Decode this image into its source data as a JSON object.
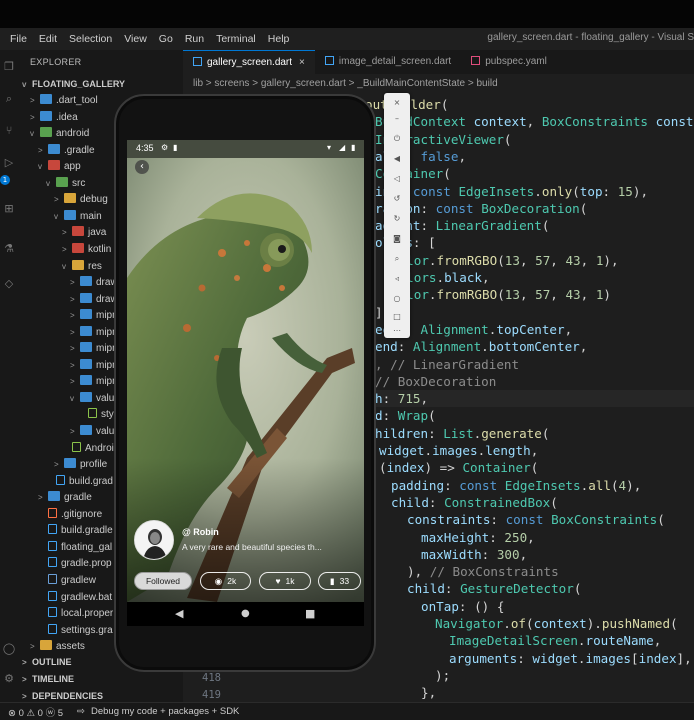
{
  "window_title": "gallery_screen.dart - floating_gallery - Visual S",
  "menu": [
    "File",
    "Edit",
    "Selection",
    "View",
    "Go",
    "Run",
    "Terminal",
    "Help"
  ],
  "sidebar": {
    "title": "EXPLORER",
    "project": "FLOATING_GALLERY",
    "rows": [
      {
        "label": ".dart_tool",
        "depth": 1,
        "kind": "folder",
        "chev": ">"
      },
      {
        "label": ".idea",
        "depth": 1,
        "kind": "folder",
        "chev": ">"
      },
      {
        "label": "android",
        "depth": 1,
        "kind": "folder g",
        "chev": "v"
      },
      {
        "label": ".gradle",
        "depth": 2,
        "kind": "folder",
        "chev": ">"
      },
      {
        "label": "app",
        "depth": 2,
        "kind": "folder r",
        "chev": "v"
      },
      {
        "label": "src",
        "depth": 3,
        "kind": "folder g",
        "chev": "v"
      },
      {
        "label": "debug",
        "depth": 4,
        "kind": "folder y",
        "chev": ">"
      },
      {
        "label": "main",
        "depth": 4,
        "kind": "folder",
        "chev": "v"
      },
      {
        "label": "java",
        "depth": 5,
        "kind": "folder r",
        "chev": ">"
      },
      {
        "label": "kotlin",
        "depth": 5,
        "kind": "folder r",
        "chev": ">"
      },
      {
        "label": "res",
        "depth": 5,
        "kind": "folder y",
        "chev": "v"
      },
      {
        "label": "drawa",
        "depth": 6,
        "kind": "folder",
        "chev": ">"
      },
      {
        "label": "drawa",
        "depth": 6,
        "kind": "folder",
        "chev": ">"
      },
      {
        "label": "mipm",
        "depth": 6,
        "kind": "folder",
        "chev": ">"
      },
      {
        "label": "mipm",
        "depth": 6,
        "kind": "folder",
        "chev": ">"
      },
      {
        "label": "mipm",
        "depth": 6,
        "kind": "folder",
        "chev": ">"
      },
      {
        "label": "mipm",
        "depth": 6,
        "kind": "folder",
        "chev": ">"
      },
      {
        "label": "mipm",
        "depth": 6,
        "kind": "folder",
        "chev": ">"
      },
      {
        "label": "values",
        "depth": 6,
        "kind": "folder",
        "chev": "v"
      },
      {
        "label": "style",
        "depth": 7,
        "kind": "file g",
        "chev": ""
      },
      {
        "label": "values",
        "depth": 6,
        "kind": "folder",
        "chev": ">"
      },
      {
        "label": "Android",
        "depth": 5,
        "kind": "file g",
        "chev": ""
      },
      {
        "label": "profile",
        "depth": 4,
        "kind": "folder",
        "chev": ">"
      },
      {
        "label": "build.grad",
        "depth": 3,
        "kind": "file d",
        "chev": ""
      },
      {
        "label": "gradle",
        "depth": 2,
        "kind": "folder",
        "chev": ">"
      },
      {
        "label": ".gitignore",
        "depth": 2,
        "kind": "file o",
        "chev": ""
      },
      {
        "label": "build.gradle",
        "depth": 2,
        "kind": "file d",
        "chev": ""
      },
      {
        "label": "floating_gal",
        "depth": 2,
        "kind": "file d",
        "chev": ""
      },
      {
        "label": "gradle.prop",
        "depth": 2,
        "kind": "file d",
        "chev": ""
      },
      {
        "label": "gradlew",
        "depth": 2,
        "kind": "file",
        "chev": ""
      },
      {
        "label": "gradlew.bat",
        "depth": 2,
        "kind": "file d",
        "chev": ""
      },
      {
        "label": "local.proper",
        "depth": 2,
        "kind": "file d",
        "chev": ""
      },
      {
        "label": "settings.gra",
        "depth": 2,
        "kind": "file d",
        "chev": ""
      },
      {
        "label": "assets",
        "depth": 1,
        "kind": "folder y",
        "chev": ">"
      }
    ],
    "sections": [
      "OUTLINE",
      "TIMELINE",
      "DEPENDENCIES"
    ]
  },
  "tabs": [
    {
      "label": "gallery_screen.dart",
      "active": true,
      "icon": "dart"
    },
    {
      "label": "image_detail_screen.dart",
      "active": false,
      "icon": "dart"
    },
    {
      "label": "pubspec.yaml",
      "active": false,
      "icon": "yaml"
    }
  ],
  "tab_close": "×",
  "breadcrumb": "lib > screens > gallery_screen.dart > _BuildMainContentState > build",
  "line_numbers": [
    "418",
    "419"
  ],
  "status_left": "⊗ 0 ⚠ 0 ⓦ 5",
  "status_debug": "Debug my code + packages + SDK",
  "phone": {
    "time": "4:35",
    "author": "@ Robin",
    "caption": "A very rare and beautiful species th...",
    "follow_label": "Followed",
    "views": "2k",
    "likes": "1k",
    "saves": "33"
  },
  "colors": {
    "accent": "#0078d4",
    "editor_bg": "#1e1e1e",
    "sidebar_bg": "#181818"
  }
}
